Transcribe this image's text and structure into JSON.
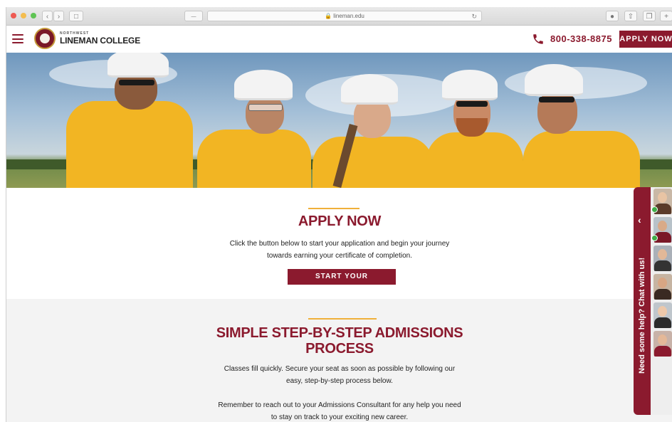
{
  "browser": {
    "url": "lineman.edu",
    "traffic_lights": [
      "#ee5a52",
      "#f4bd4f",
      "#5fc454"
    ]
  },
  "header": {
    "logo_small": "NORTHWEST",
    "logo_main": "LINEMAN COLLEGE",
    "phone": "800-338-8875",
    "apply_label": "APPLY NOW"
  },
  "apply": {
    "title": "APPLY NOW",
    "line1": "Click the button below to start your application and begin your journey",
    "line2": "towards earning your certificate of completion.",
    "button": "START YOUR APPLICATION"
  },
  "process": {
    "title_line1": "SIMPLE STEP-BY-STEP ADMISSIONS",
    "title_line2": "PROCESS",
    "p1_line1": "Classes fill quickly. Secure your seat as soon as possible by following our",
    "p1_line2": "easy, step-by-step process below.",
    "p2_line1": "Remember to reach out to your Admissions Consultant for any help you need",
    "p2_line2": "to stay on track to your exciting new career."
  },
  "chat": {
    "label": "Need some help? Chat with us!"
  },
  "colors": {
    "brand": "#8b1a2e",
    "accent": "#f0b03a"
  }
}
